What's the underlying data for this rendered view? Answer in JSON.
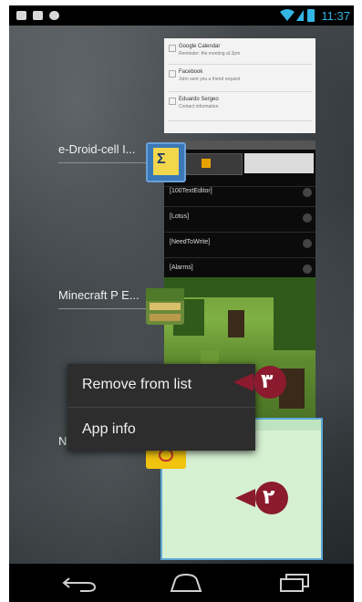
{
  "status_bar": {
    "time": "11:37",
    "left_icons": [
      "notification-icon",
      "notification-icon",
      "gamepad-icon"
    ],
    "accent": "#33b5e5"
  },
  "gmail_card": {
    "notifications": [
      {
        "title": "Google Calendar",
        "snippet": "Reminder: the meeting at 2pm"
      },
      {
        "title": "Facebook",
        "snippet": "John sent you a friend request"
      },
      {
        "title": "Eduardo Sergeo",
        "snippet": "Contact information"
      }
    ]
  },
  "recent_apps": [
    {
      "label": "e-Droid-cell I...",
      "icon": "e-droid-icon"
    },
    {
      "label": "Minecraft P E...",
      "icon": "minecraft-icon"
    },
    {
      "label": "N",
      "icon": "notes-icon"
    }
  ],
  "droid_card": {
    "rows": [
      "[100TextEditor]",
      "[Lotus]",
      "[NeedToWrite]",
      "[Alarms]"
    ]
  },
  "context_menu": {
    "items": [
      "Remove from list",
      "App info"
    ]
  },
  "callouts": {
    "menu_badge": "٣",
    "card_badge": "٢",
    "badge_color": "#8b1a2e"
  },
  "nav_bar": {
    "icons": [
      "back-icon",
      "home-icon",
      "recent-apps-icon"
    ]
  }
}
